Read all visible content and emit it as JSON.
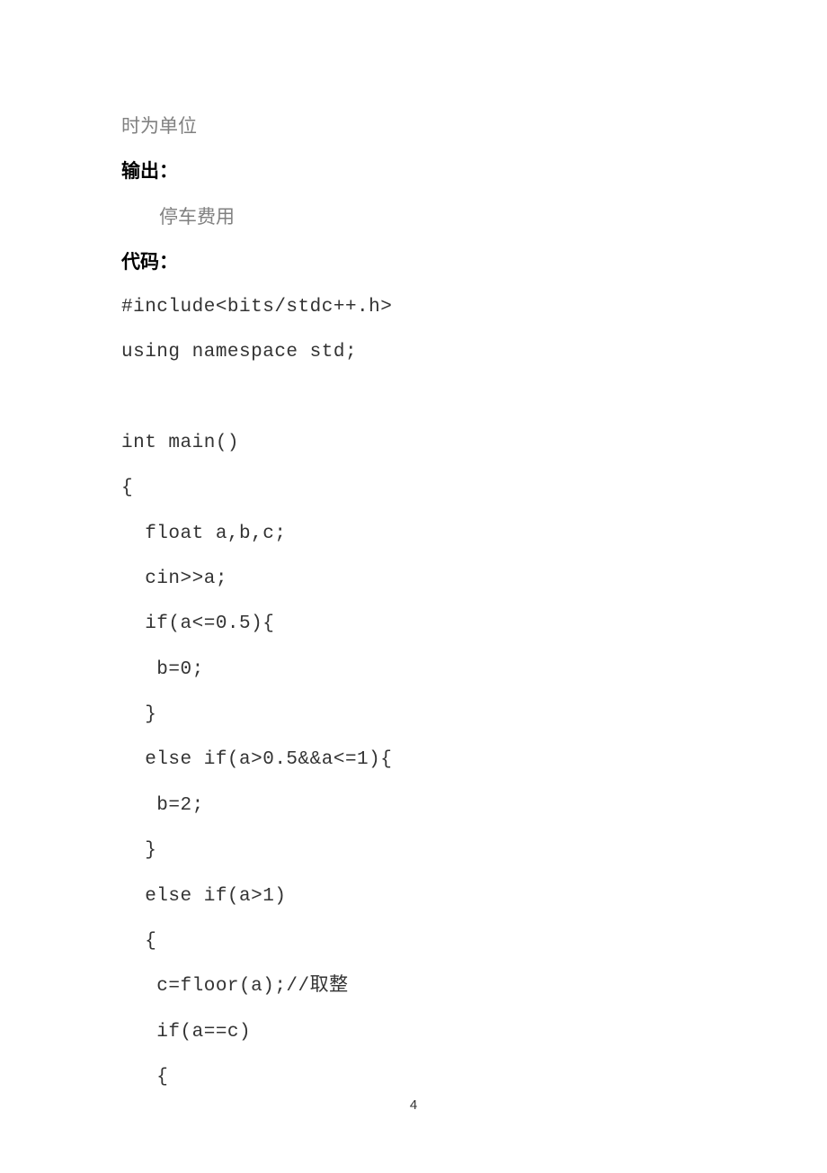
{
  "line_unit": "时为单位",
  "heading_output": "输出：",
  "output_text": "停车费用",
  "heading_code": "代码：",
  "code": {
    "l1": "#include<bits/stdc++.h>",
    "l2": "using namespace std;",
    "l3": "int main()",
    "l4": "{",
    "l5": "  float a,b,c;",
    "l6": "  cin>>a;",
    "l7": "  if(a<=0.5){",
    "l8": "   b=0;",
    "l9": "  }",
    "l10": "  else if(a>0.5&&a<=1){",
    "l11": "   b=2;",
    "l12": "  }",
    "l13": "  else if(a>1)",
    "l14": "  {",
    "l15": "   c=floor(a);//取整",
    "l16": "   if(a==c)",
    "l17": "   {"
  },
  "page_number": "4"
}
